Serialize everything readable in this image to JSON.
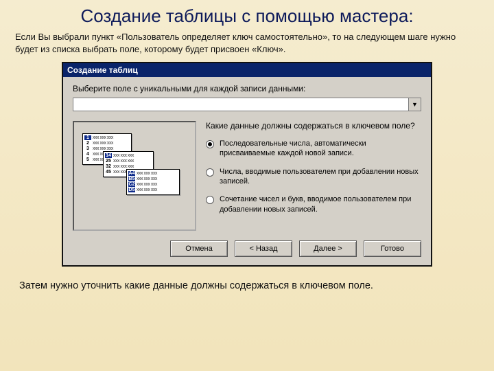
{
  "title": "Создание таблицы с помощью мастера:",
  "intro": "Если Вы выбрали пункт «Пользователь определяет ключ самостоятельно», то на следующем шаге нужно будет из списка выбрать поле, которому будет присвоен «Ключ».",
  "dialog": {
    "titlebar": "Создание таблиц",
    "prompt": "Выберите поле с уникальными для каждой записи данными:",
    "question": "Какие данные должны содержаться в ключевом поле?",
    "options": [
      "Последовательные числа, автоматически присваиваемые каждой новой записи.",
      "Числа, вводимые пользователем при добавлении новых записей.",
      "Сочетание чисел и букв, вводимое пользователем при добавлении новых записей."
    ],
    "selected": 0,
    "buttons": {
      "cancel": "Отмена",
      "back": "< Назад",
      "next": "Далее >",
      "finish": "Готово"
    }
  },
  "illustration": {
    "sheet1_rows": [
      "1",
      "2",
      "3",
      "4",
      "5"
    ],
    "sheet2_rows": [
      "14",
      "25",
      "32",
      "45"
    ],
    "sheet3_rows": [
      "A4",
      "B5",
      "C2",
      "D5"
    ],
    "placeholder": "xxx xxx xxx"
  },
  "outro": "Затем нужно уточнить какие данные должны содержаться в ключевом поле."
}
